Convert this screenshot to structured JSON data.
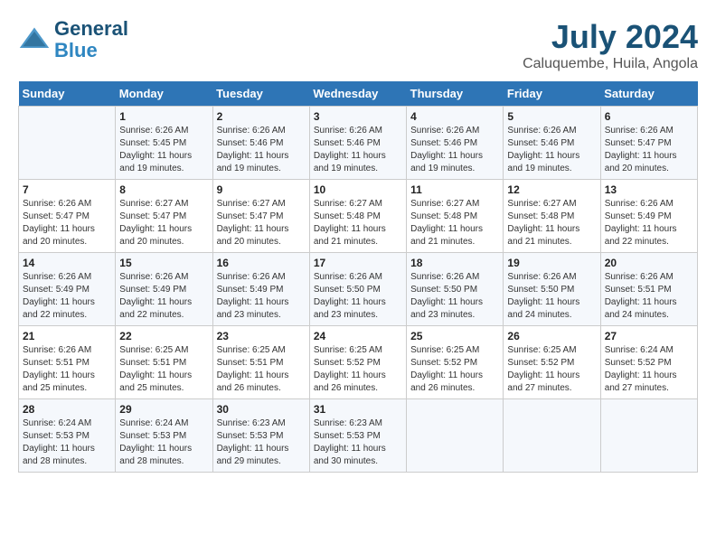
{
  "logo": {
    "line1": "General",
    "line2": "Blue"
  },
  "title": "July 2024",
  "subtitle": "Caluquembe, Huila, Angola",
  "days_of_week": [
    "Sunday",
    "Monday",
    "Tuesday",
    "Wednesday",
    "Thursday",
    "Friday",
    "Saturday"
  ],
  "weeks": [
    [
      {
        "day": "",
        "info": ""
      },
      {
        "day": "1",
        "info": "Sunrise: 6:26 AM\nSunset: 5:45 PM\nDaylight: 11 hours and 19 minutes."
      },
      {
        "day": "2",
        "info": "Sunrise: 6:26 AM\nSunset: 5:46 PM\nDaylight: 11 hours and 19 minutes."
      },
      {
        "day": "3",
        "info": "Sunrise: 6:26 AM\nSunset: 5:46 PM\nDaylight: 11 hours and 19 minutes."
      },
      {
        "day": "4",
        "info": "Sunrise: 6:26 AM\nSunset: 5:46 PM\nDaylight: 11 hours and 19 minutes."
      },
      {
        "day": "5",
        "info": "Sunrise: 6:26 AM\nSunset: 5:46 PM\nDaylight: 11 hours and 19 minutes."
      },
      {
        "day": "6",
        "info": "Sunrise: 6:26 AM\nSunset: 5:47 PM\nDaylight: 11 hours and 20 minutes."
      }
    ],
    [
      {
        "day": "7",
        "info": "Sunrise: 6:26 AM\nSunset: 5:47 PM\nDaylight: 11 hours and 20 minutes."
      },
      {
        "day": "8",
        "info": "Sunrise: 6:27 AM\nSunset: 5:47 PM\nDaylight: 11 hours and 20 minutes."
      },
      {
        "day": "9",
        "info": "Sunrise: 6:27 AM\nSunset: 5:47 PM\nDaylight: 11 hours and 20 minutes."
      },
      {
        "day": "10",
        "info": "Sunrise: 6:27 AM\nSunset: 5:48 PM\nDaylight: 11 hours and 21 minutes."
      },
      {
        "day": "11",
        "info": "Sunrise: 6:27 AM\nSunset: 5:48 PM\nDaylight: 11 hours and 21 minutes."
      },
      {
        "day": "12",
        "info": "Sunrise: 6:27 AM\nSunset: 5:48 PM\nDaylight: 11 hours and 21 minutes."
      },
      {
        "day": "13",
        "info": "Sunrise: 6:26 AM\nSunset: 5:49 PM\nDaylight: 11 hours and 22 minutes."
      }
    ],
    [
      {
        "day": "14",
        "info": "Sunrise: 6:26 AM\nSunset: 5:49 PM\nDaylight: 11 hours and 22 minutes."
      },
      {
        "day": "15",
        "info": "Sunrise: 6:26 AM\nSunset: 5:49 PM\nDaylight: 11 hours and 22 minutes."
      },
      {
        "day": "16",
        "info": "Sunrise: 6:26 AM\nSunset: 5:49 PM\nDaylight: 11 hours and 23 minutes."
      },
      {
        "day": "17",
        "info": "Sunrise: 6:26 AM\nSunset: 5:50 PM\nDaylight: 11 hours and 23 minutes."
      },
      {
        "day": "18",
        "info": "Sunrise: 6:26 AM\nSunset: 5:50 PM\nDaylight: 11 hours and 23 minutes."
      },
      {
        "day": "19",
        "info": "Sunrise: 6:26 AM\nSunset: 5:50 PM\nDaylight: 11 hours and 24 minutes."
      },
      {
        "day": "20",
        "info": "Sunrise: 6:26 AM\nSunset: 5:51 PM\nDaylight: 11 hours and 24 minutes."
      }
    ],
    [
      {
        "day": "21",
        "info": "Sunrise: 6:26 AM\nSunset: 5:51 PM\nDaylight: 11 hours and 25 minutes."
      },
      {
        "day": "22",
        "info": "Sunrise: 6:25 AM\nSunset: 5:51 PM\nDaylight: 11 hours and 25 minutes."
      },
      {
        "day": "23",
        "info": "Sunrise: 6:25 AM\nSunset: 5:51 PM\nDaylight: 11 hours and 26 minutes."
      },
      {
        "day": "24",
        "info": "Sunrise: 6:25 AM\nSunset: 5:52 PM\nDaylight: 11 hours and 26 minutes."
      },
      {
        "day": "25",
        "info": "Sunrise: 6:25 AM\nSunset: 5:52 PM\nDaylight: 11 hours and 26 minutes."
      },
      {
        "day": "26",
        "info": "Sunrise: 6:25 AM\nSunset: 5:52 PM\nDaylight: 11 hours and 27 minutes."
      },
      {
        "day": "27",
        "info": "Sunrise: 6:24 AM\nSunset: 5:52 PM\nDaylight: 11 hours and 27 minutes."
      }
    ],
    [
      {
        "day": "28",
        "info": "Sunrise: 6:24 AM\nSunset: 5:53 PM\nDaylight: 11 hours and 28 minutes."
      },
      {
        "day": "29",
        "info": "Sunrise: 6:24 AM\nSunset: 5:53 PM\nDaylight: 11 hours and 28 minutes."
      },
      {
        "day": "30",
        "info": "Sunrise: 6:23 AM\nSunset: 5:53 PM\nDaylight: 11 hours and 29 minutes."
      },
      {
        "day": "31",
        "info": "Sunrise: 6:23 AM\nSunset: 5:53 PM\nDaylight: 11 hours and 30 minutes."
      },
      {
        "day": "",
        "info": ""
      },
      {
        "day": "",
        "info": ""
      },
      {
        "day": "",
        "info": ""
      }
    ]
  ]
}
